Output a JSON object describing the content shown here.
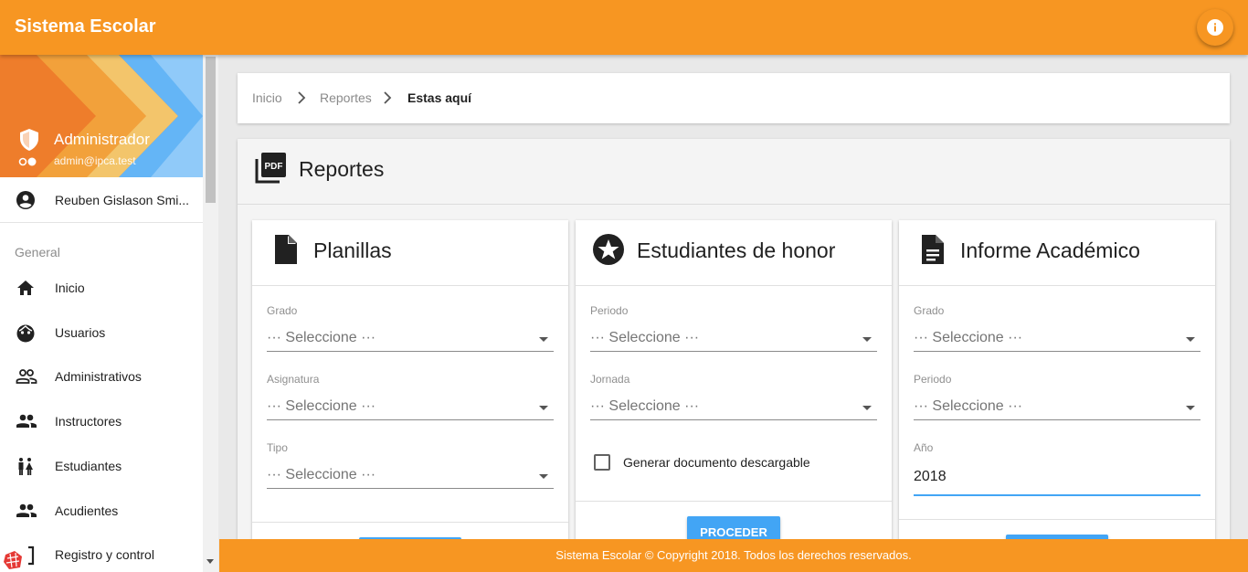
{
  "app": {
    "title": "Sistema Escolar"
  },
  "sidebar": {
    "admin_name": "Administrador",
    "admin_email": "admin@ipca.test",
    "user_name": "Reuben Gislason Smi...",
    "section_label": "General",
    "items": [
      {
        "label": "Inicio",
        "icon": "home-icon"
      },
      {
        "label": "Usuarios",
        "icon": "face-icon"
      },
      {
        "label": "Administrativos",
        "icon": "people-outline-icon"
      },
      {
        "label": "Instructores",
        "icon": "people-icon"
      },
      {
        "label": "Estudiantes",
        "icon": "wc-icon"
      },
      {
        "label": "Acudientes",
        "icon": "people-icon"
      },
      {
        "label": "Registro y control",
        "icon": "bracket-icon"
      }
    ]
  },
  "breadcrumb": {
    "items": [
      "Inicio",
      "Reportes"
    ],
    "current": "Estas aquí"
  },
  "reports": {
    "title": "Reportes",
    "cards": [
      {
        "title": "Planillas",
        "fields": [
          {
            "label": "Grado",
            "value": "··· Seleccione ···"
          },
          {
            "label": "Asignatura",
            "value": "··· Seleccione ···"
          },
          {
            "label": "Tipo",
            "value": "··· Seleccione ···"
          }
        ]
      },
      {
        "title": "Estudiantes de honor",
        "fields": [
          {
            "label": "Periodo",
            "value": "··· Seleccione ···"
          },
          {
            "label": "Jornada",
            "value": "··· Seleccione ···"
          }
        ],
        "checkbox_label": "Generar documento descargable",
        "checkbox_checked": false,
        "button_label": "PROCEDER"
      },
      {
        "title": "Informe Académico",
        "fields": [
          {
            "label": "Grado",
            "value": "··· Seleccione ···"
          },
          {
            "label": "Periodo",
            "value": "··· Seleccione ···"
          }
        ],
        "year_label": "Año",
        "year_value": "2018"
      }
    ]
  },
  "footer": {
    "text": "Sistema Escolar © Copyright 2018. Todos los derechos reservados."
  },
  "colors": {
    "primary": "#f79622",
    "accent": "#42a5f5"
  }
}
